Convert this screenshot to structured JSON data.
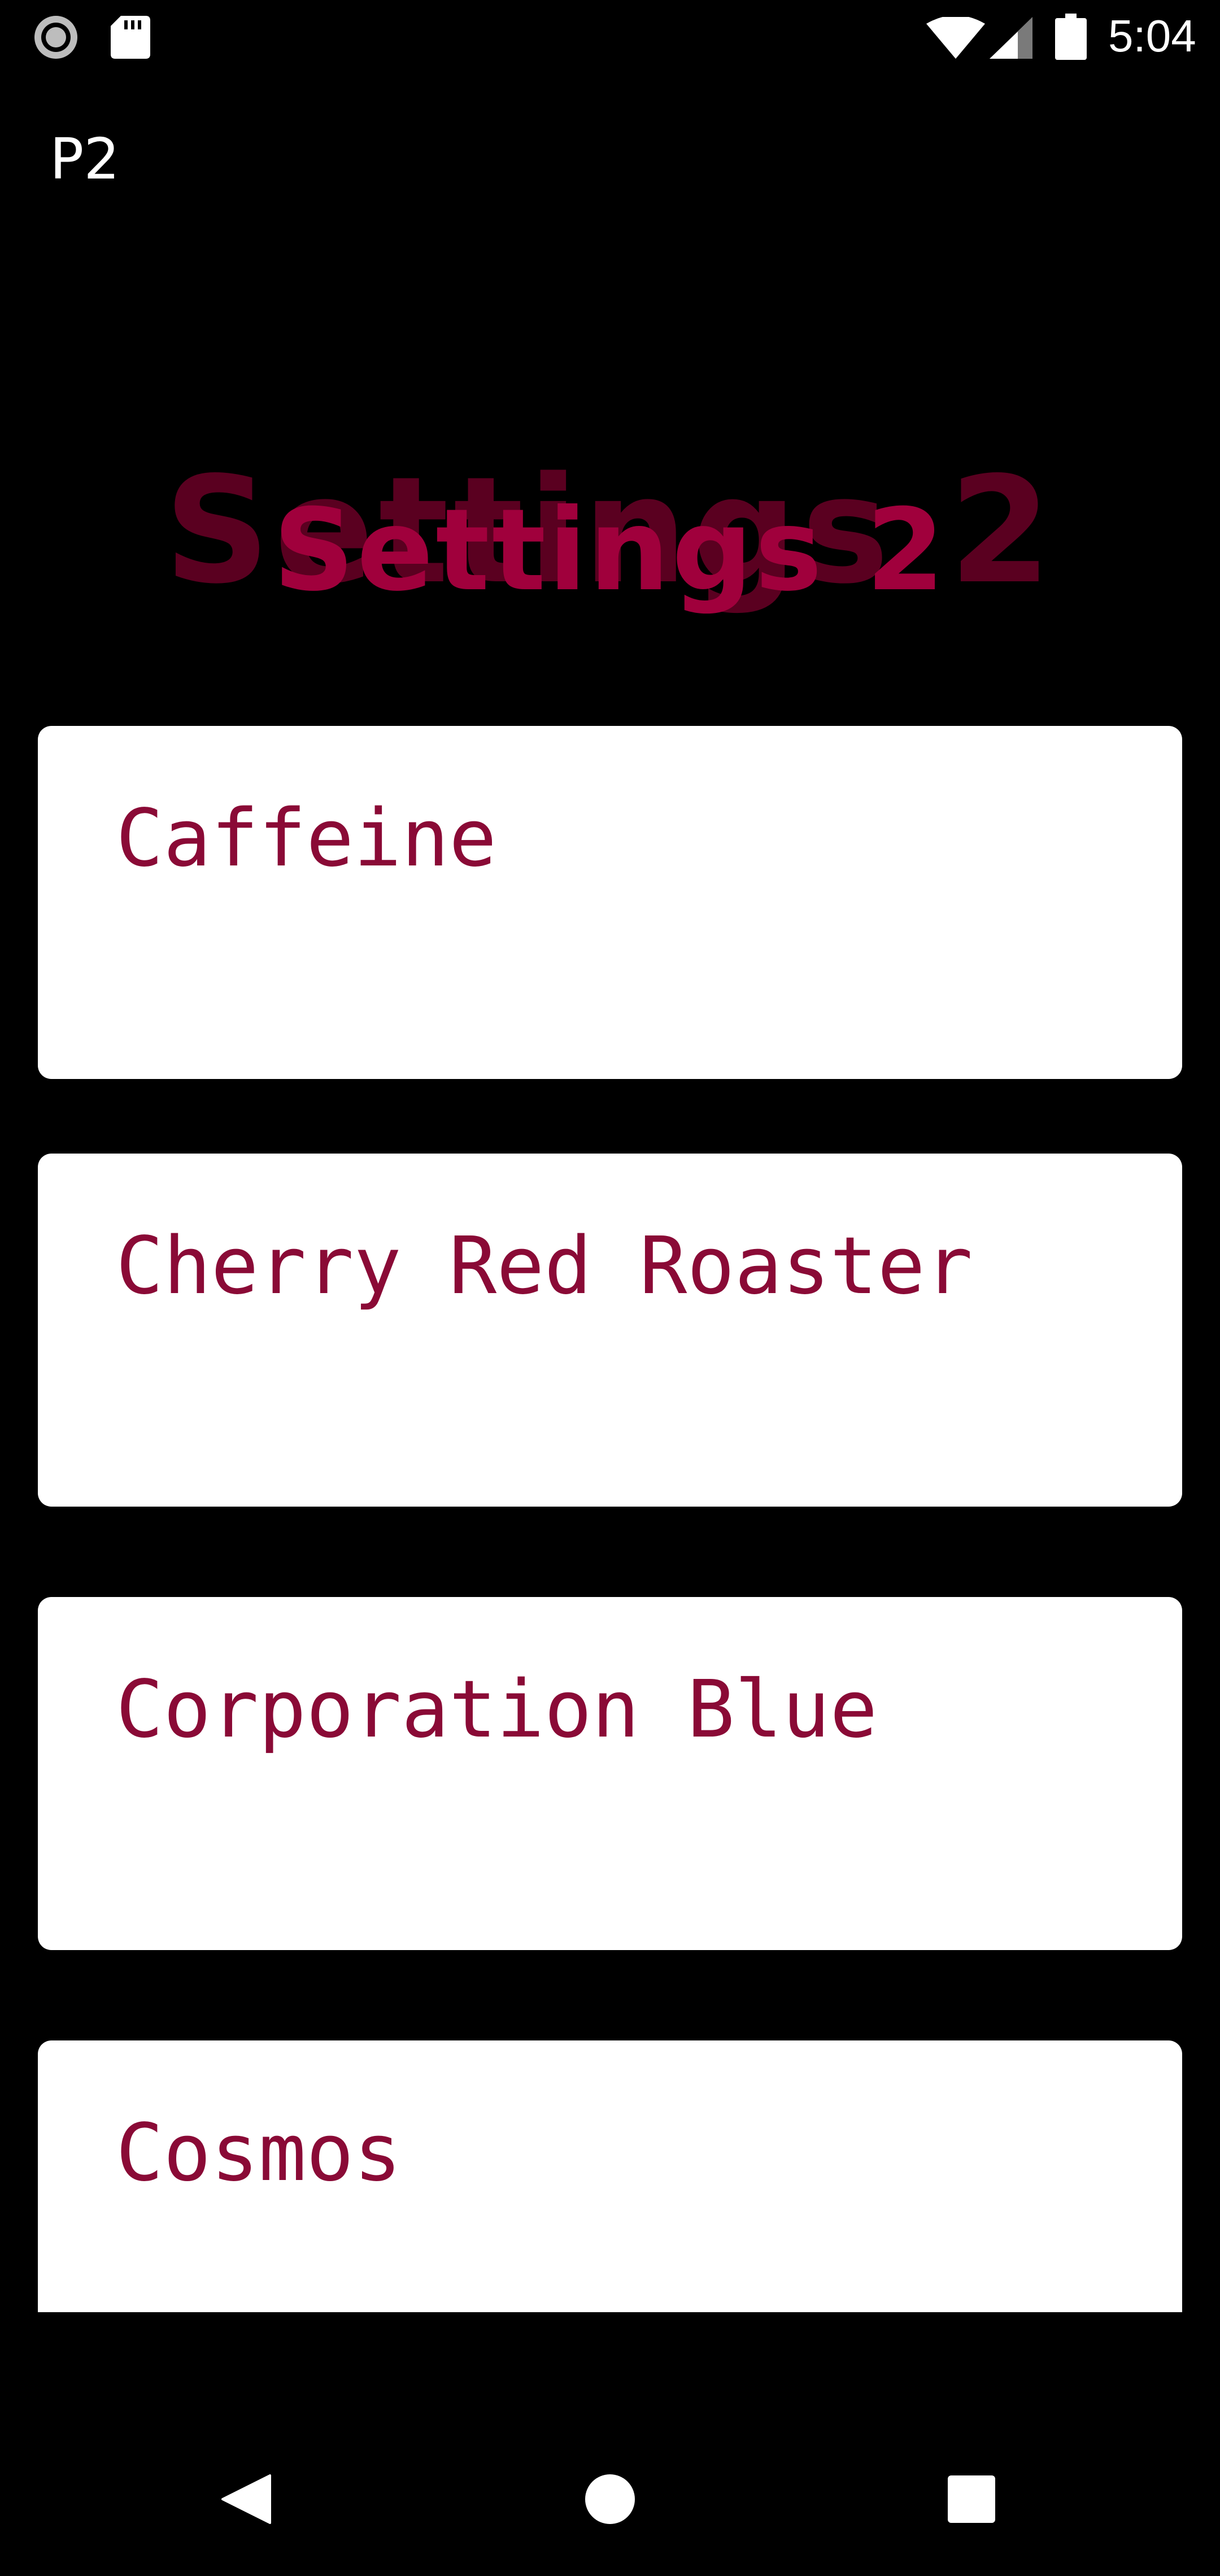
{
  "status_bar": {
    "time": "5:04",
    "icons": [
      "record-icon",
      "sd-card-icon",
      "wifi-icon",
      "cell-signal-icon",
      "battery-icon"
    ]
  },
  "app_bar": {
    "title": "P2"
  },
  "heading": {
    "text": "Settings 2"
  },
  "list": {
    "items": [
      {
        "label": "Caffeine"
      },
      {
        "label": "Cherry Red Roaster"
      },
      {
        "label": "Corporation Blue"
      },
      {
        "label": "Cosmos"
      }
    ]
  },
  "nav_bar": {
    "icons": [
      "back-icon",
      "home-icon",
      "recents-icon"
    ]
  },
  "colors": {
    "background": "#000000",
    "card": "#ffffff",
    "accent": "#8a0a36",
    "heading_front": "#a0003c",
    "heading_back": "#5a0020"
  }
}
